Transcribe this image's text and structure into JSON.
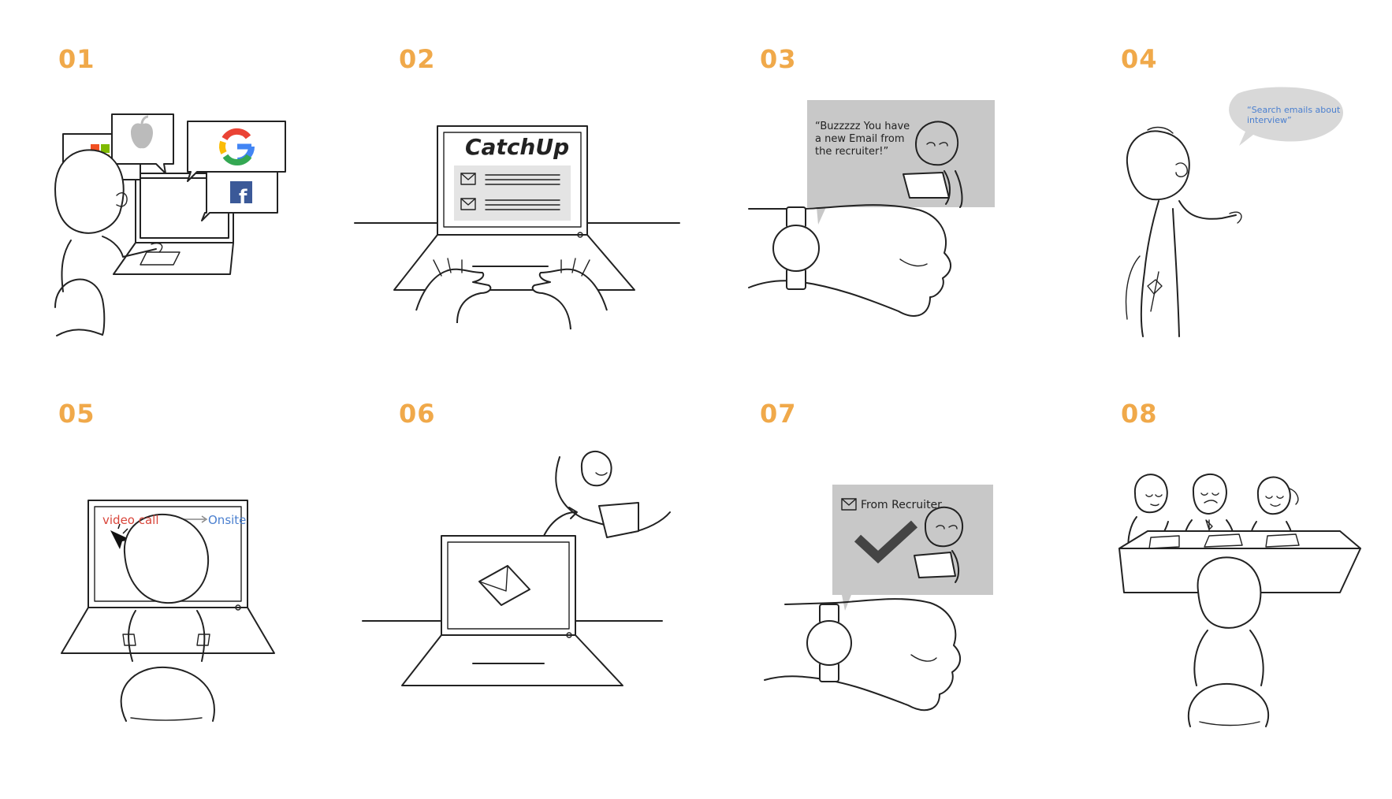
{
  "panels": [
    {
      "number": "01"
    },
    {
      "number": "02",
      "screen_title": "CatchUp"
    },
    {
      "number": "03",
      "bubble_text": [
        "“Buzzzzz You have",
        "a new Email from",
        "the recruiter!”"
      ]
    },
    {
      "number": "04",
      "speech_text": [
        "“Search emails about",
        "interview”"
      ]
    },
    {
      "number": "05",
      "from_label": "video call",
      "to_label": "Onsite"
    },
    {
      "number": "06"
    },
    {
      "number": "07",
      "notification_label": "From Recruiter"
    },
    {
      "number": "08"
    }
  ],
  "colors": {
    "number": "#f0a94a",
    "bubble_gray": "#c8c8c8",
    "speech_blue": "#4a7fcf",
    "video_call_red": "#d9463b",
    "onsite_blue": "#4a7fcf",
    "google_blue": "#4285f4",
    "facebook_blue": "#3b5998"
  },
  "icons": [
    "microsoft-logo-icon",
    "apple-logo-icon",
    "google-logo-icon",
    "facebook-logo-icon",
    "envelope-icon",
    "smartwatch-icon",
    "mouse-cursor-icon",
    "checkmark-icon"
  ]
}
